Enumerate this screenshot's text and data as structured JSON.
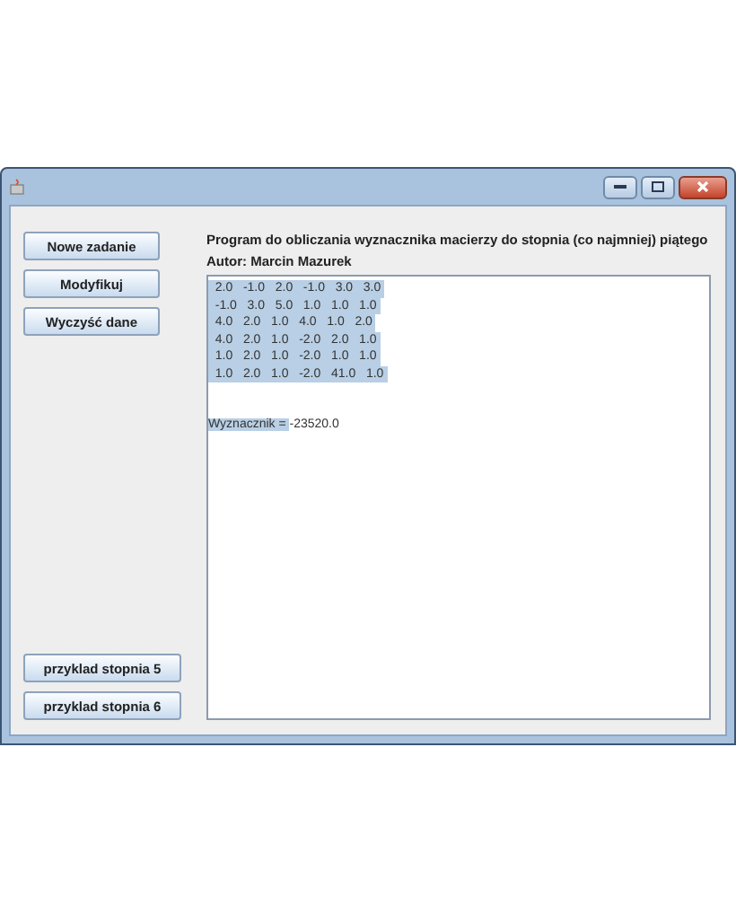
{
  "window": {
    "title_controls": [
      {
        "kind": "minimize"
      },
      {
        "kind": "maximize"
      },
      {
        "kind": "close"
      }
    ]
  },
  "buttons_top": [
    "Nowe zadanie",
    "Modyfikuj",
    "Wyczyść dane"
  ],
  "buttons_bottom": [
    "przyklad stopnia 5",
    "przyklad stopnia 6"
  ],
  "heading": "Program do obliczania wyznacznika macierzy do stopnia (co najmniej) piątego",
  "author": "Autor: Marcin Mazurek",
  "text_area": {
    "lines": [
      {
        "text": "  2.0   -1.0   2.0   -1.0   3.0   3.0",
        "selected": true
      },
      {
        "text": "  -1.0   3.0   5.0   1.0   1.0   1.0",
        "selected": true
      },
      {
        "text": "  4.0   2.0   1.0   4.0   1.0   2.0",
        "selected": true
      },
      {
        "text": "  4.0   2.0   1.0   -2.0   2.0   1.0",
        "selected": true
      },
      {
        "text": "  1.0   2.0   1.0   -2.0   1.0   1.0",
        "selected": true
      },
      {
        "text": "  1.0   2.0   1.0   -2.0   41.0   1.0",
        "selected": true
      }
    ],
    "result": {
      "selected_text": "Wyznacznik = ",
      "text": "-23520.0"
    }
  }
}
